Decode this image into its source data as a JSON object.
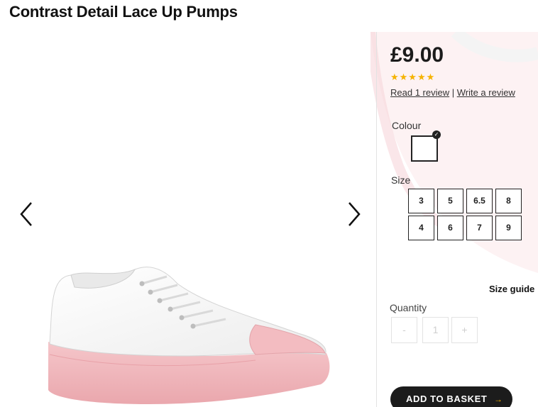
{
  "product": {
    "title": "Contrast Detail Lace Up Pumps",
    "price": "£9.00",
    "rating_stars": "★★★★★",
    "rating": 5,
    "review_link": "Read 1 review",
    "review_separator": " | ",
    "write_review_link": "Write a review"
  },
  "gallery": {
    "prev_icon": "chevron-left-icon",
    "next_icon": "chevron-right-icon"
  },
  "colour": {
    "label": "Colour",
    "selected_check": "✓"
  },
  "size": {
    "label": "Size",
    "options": [
      "3",
      "5",
      "6.5",
      "8",
      "4",
      "6",
      "7",
      "9"
    ],
    "guide_label": "Size guide"
  },
  "quantity": {
    "label": "Quantity",
    "minus": "-",
    "value": "1",
    "plus": "+"
  },
  "basket": {
    "label": "ADD TO BASKET",
    "arrow": "→"
  },
  "colors": {
    "accent_star": "#f5b300",
    "button_bg": "#1c1c1c",
    "shoe_sole": "#f1b8bd"
  }
}
